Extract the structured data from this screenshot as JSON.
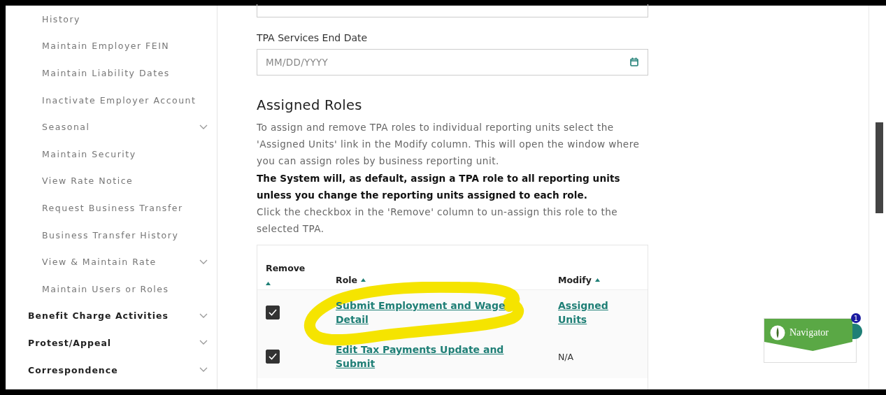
{
  "sidebar": {
    "sub_items": [
      {
        "label": "History",
        "expandable": false
      },
      {
        "label": "Maintain Employer FEIN",
        "expandable": false
      },
      {
        "label": "Maintain Liability Dates",
        "expandable": false
      },
      {
        "label": "Inactivate Employer Account",
        "expandable": false
      },
      {
        "label": "Seasonal",
        "expandable": true
      },
      {
        "label": "Maintain Security",
        "expandable": false
      },
      {
        "label": "View Rate Notice",
        "expandable": false
      },
      {
        "label": "Request Business Transfer",
        "expandable": false
      },
      {
        "label": "Business Transfer History",
        "expandable": false
      },
      {
        "label": "View & Maintain Rate",
        "expandable": true
      },
      {
        "label": "Maintain Users or Roles",
        "expandable": false
      }
    ],
    "sections": [
      {
        "label": "Benefit Charge Activities",
        "expandable": true
      },
      {
        "label": "Protest/Appeal",
        "expandable": true
      },
      {
        "label": "Correspondence",
        "expandable": true
      }
    ]
  },
  "end_date": {
    "label": "TPA Services End Date",
    "placeholder": "MM/DD/YYYY"
  },
  "assigned_roles": {
    "title": "Assigned Roles",
    "paragraphs": [
      {
        "text": "To assign and remove TPA roles to individual reporting units select the 'Assigned Units' link in the Modify column. This will open the window where you can assign roles by business reporting unit.",
        "bold": false
      },
      {
        "text": "The System will, as default, assign a TPA role to all reporting units unless you change the reporting units assigned to each role.",
        "bold": true
      },
      {
        "text": "Click the checkbox in the 'Remove' column to un-assign this role to the selected TPA.",
        "bold": false
      }
    ]
  },
  "table": {
    "columns": [
      "Remove",
      "Role",
      "Modify"
    ],
    "rows": [
      {
        "checked": true,
        "role": "Submit Employment and Wage Detail",
        "modify": {
          "text": "Assigned Units",
          "kind": "link"
        }
      },
      {
        "checked": true,
        "role": "Edit Tax Payments Update and Submit",
        "modify": {
          "text": "N/A",
          "kind": "text"
        }
      }
    ]
  },
  "navigator": {
    "label": "Navigator",
    "badge": "1"
  }
}
